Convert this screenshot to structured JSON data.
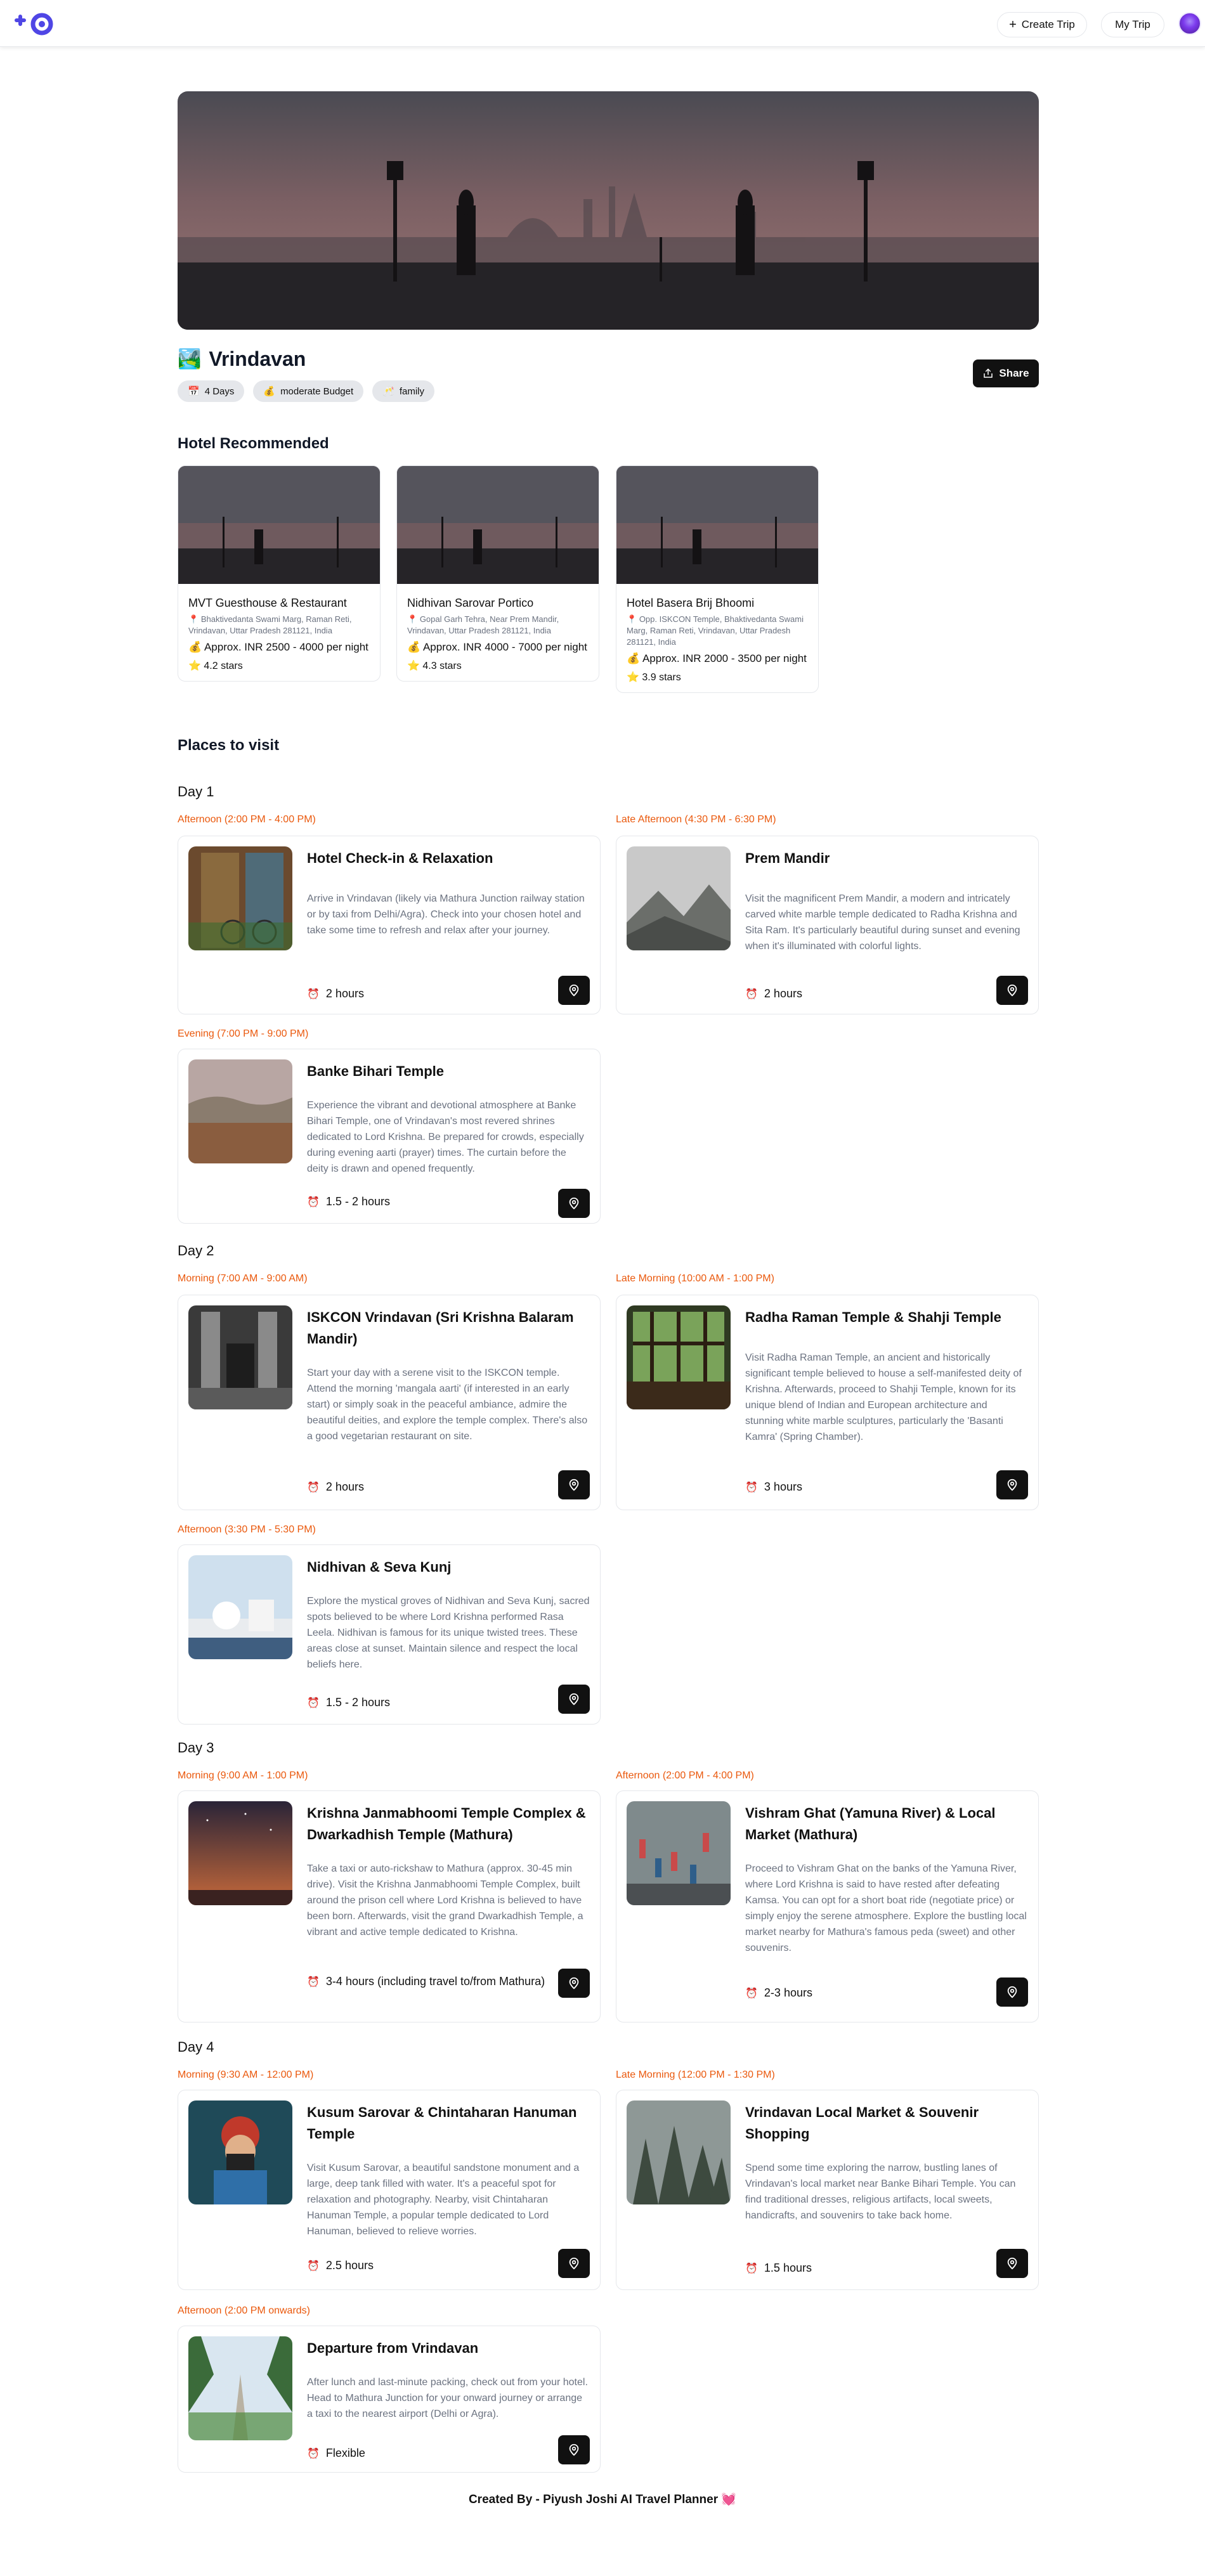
{
  "header": {
    "create_trip_label": "Create Trip",
    "my_trip_label": "My Trip",
    "brand_color": "#4f46e5"
  },
  "trip": {
    "emoji": "🏞️",
    "destination": "Vrindavan",
    "share_label": "Share",
    "pills": [
      {
        "icon": "📅",
        "label": "4 Days"
      },
      {
        "icon": "💰",
        "label": "moderate Budget"
      },
      {
        "icon": "🥂",
        "label": "family"
      }
    ]
  },
  "hotels_heading": "Hotel Recommended",
  "hotels": [
    {
      "name": "MVT Guesthouse & Restaurant",
      "address": "Bhaktivedanta Swami Marg, Raman Reti, Vrindavan, Uttar Pradesh 281121, India",
      "price": "Approx. INR 2500 - 4000 per night",
      "rating": "4.2 stars"
    },
    {
      "name": "Nidhivan Sarovar Portico",
      "address": "Gopal Garh Tehra, Near Prem Mandir, Vrindavan, Uttar Pradesh 281121, India",
      "price": "Approx. INR 4000 - 7000 per night",
      "rating": "4.3 stars"
    },
    {
      "name": "Hotel Basera Brij Bhoomi",
      "address": "Opp. ISKCON Temple, Bhaktivedanta Swami Marg, Raman Reti, Vrindavan, Uttar Pradesh 281121, India",
      "price": "Approx. INR 2000 - 3500 per night",
      "rating": "3.9 stars"
    }
  ],
  "places_heading": "Places to visit",
  "days": [
    {
      "label": "Day 1",
      "places": [
        {
          "time": "Afternoon (2:00 PM - 4:00 PM)",
          "name": "Hotel Check-in & Relaxation",
          "details": "Arrive in Vrindavan (likely via Mathura Junction railway station or by taxi from Delhi/Agra). Check into your chosen hotel and take some time to refresh and relax after your journey.",
          "duration": "2 hours"
        },
        {
          "time": "Late Afternoon (4:30 PM - 6:30 PM)",
          "name": "Prem Mandir",
          "details": "Visit the magnificent Prem Mandir, a modern and intricately carved white marble temple dedicated to Radha Krishna and Sita Ram. It's particularly beautiful during sunset and evening when it's illuminated with colorful lights.",
          "duration": "2 hours"
        },
        {
          "time": "Evening (7:00 PM - 9:00 PM)",
          "name": "Banke Bihari Temple",
          "details": "Experience the vibrant and devotional atmosphere at Banke Bihari Temple, one of Vrindavan's most revered shrines dedicated to Lord Krishna. Be prepared for crowds, especially during evening aarti (prayer) times. The curtain before the deity is drawn and opened frequently.",
          "duration": "1.5 - 2 hours"
        }
      ]
    },
    {
      "label": "Day 2",
      "places": [
        {
          "time": "Morning (7:00 AM - 9:00 AM)",
          "name": "ISKCON Vrindavan (Sri Krishna Balaram Mandir)",
          "details": "Start your day with a serene visit to the ISKCON temple. Attend the morning 'mangala aarti' (if interested in an early start) or simply soak in the peaceful ambiance, admire the beautiful deities, and explore the temple complex. There's also a good vegetarian restaurant on site.",
          "duration": "2 hours"
        },
        {
          "time": "Late Morning (10:00 AM - 1:00 PM)",
          "name": "Radha Raman Temple & Shahji Temple",
          "details": "Visit Radha Raman Temple, an ancient and historically significant temple believed to house a self-manifested deity of Krishna. Afterwards, proceed to Shahji Temple, known for its unique blend of Indian and European architecture and stunning white marble sculptures, particularly the 'Basanti Kamra' (Spring Chamber).",
          "duration": "3 hours"
        },
        {
          "time": "Afternoon (3:30 PM - 5:30 PM)",
          "name": "Nidhivan & Seva Kunj",
          "details": "Explore the mystical groves of Nidhivan and Seva Kunj, sacred spots believed to be where Lord Krishna performed Rasa Leela. Nidhivan is famous for its unique twisted trees. These areas close at sunset. Maintain silence and respect the local beliefs here.",
          "duration": "1.5 - 2 hours"
        }
      ]
    },
    {
      "label": "Day 3",
      "places": [
        {
          "time": "Morning (9:00 AM - 1:00 PM)",
          "name": "Krishna Janmabhoomi Temple Complex & Dwarkadhish Temple (Mathura)",
          "details": "Take a taxi or auto-rickshaw to Mathura (approx. 30-45 min drive). Visit the Krishna Janmabhoomi Temple Complex, built around the prison cell where Lord Krishna is believed to have been born. Afterwards, visit the grand Dwarkadhish Temple, a vibrant and active temple dedicated to Krishna.",
          "duration": "3-4 hours (including travel to/from Mathura)"
        },
        {
          "time": "Afternoon (2:00 PM - 4:00 PM)",
          "name": "Vishram Ghat (Yamuna River) & Local Market (Mathura)",
          "details": "Proceed to Vishram Ghat on the banks of the Yamuna River, where Lord Krishna is said to have rested after defeating Kamsa. You can opt for a short boat ride (negotiate price) or simply enjoy the serene atmosphere. Explore the bustling local market nearby for Mathura's famous peda (sweet) and other souvenirs.",
          "duration": "2-3 hours"
        }
      ]
    },
    {
      "label": "Day 4",
      "places": [
        {
          "time": "Morning (9:30 AM - 12:00 PM)",
          "name": "Kusum Sarovar & Chintaharan Hanuman Temple",
          "details": "Visit Kusum Sarovar, a beautiful sandstone monument and a large, deep tank filled with water. It's a peaceful spot for relaxation and photography. Nearby, visit Chintaharan Hanuman Temple, a popular temple dedicated to Lord Hanuman, believed to relieve worries.",
          "duration": "2.5 hours"
        },
        {
          "time": "Late Morning (12:00 PM - 1:30 PM)",
          "name": "Vrindavan Local Market & Souvenir Shopping",
          "details": "Spend some time exploring the narrow, bustling lanes of Vrindavan's local market near Banke Bihari Temple. You can find traditional dresses, religious artifacts, local sweets, handicrafts, and souvenirs to take back home.",
          "duration": "1.5 hours"
        },
        {
          "time": "Afternoon (2:00 PM onwards)",
          "name": "Departure from Vrindavan",
          "details": "After lunch and last-minute packing, check out from your hotel. Head to Mathura Junction for your onward journey or arrange a taxi to the nearest airport (Delhi or Agra).",
          "duration": "Flexible"
        }
      ]
    }
  ],
  "footer": "Created By - Piyush Joshi AI Travel Planner 💓"
}
